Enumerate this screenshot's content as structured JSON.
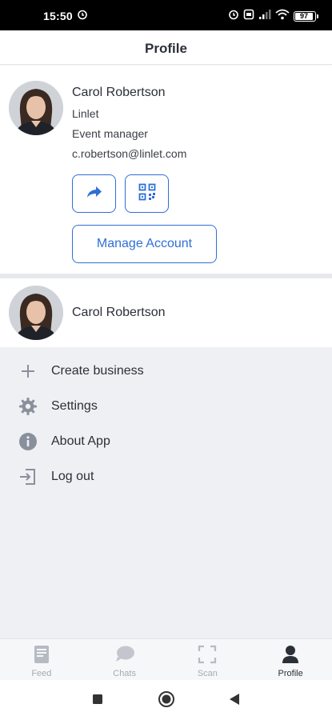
{
  "status_bar": {
    "time": "15:50",
    "battery": "97",
    "icons": [
      "alarm-icon",
      "alarm-clock-icon",
      "sim-icon",
      "signal-icon",
      "wifi-icon",
      "battery-icon"
    ]
  },
  "header": {
    "title": "Profile"
  },
  "profile": {
    "name": "Carol Robertson",
    "company": "Linlet",
    "role": "Event manager",
    "email": "c.robertson@linlet.com",
    "manage_account_label": "Manage Account"
  },
  "account": {
    "name": "Carol Robertson"
  },
  "menu": {
    "items": [
      {
        "label": "Create business",
        "icon": "plus-icon"
      },
      {
        "label": "Settings",
        "icon": "gear-icon"
      },
      {
        "label": "About App",
        "icon": "info-icon"
      },
      {
        "label": "Log out",
        "icon": "logout-icon"
      }
    ]
  },
  "bottom_nav": {
    "items": [
      {
        "label": "Feed",
        "icon": "feed-icon"
      },
      {
        "label": "Chats",
        "icon": "chat-icon"
      },
      {
        "label": "Scan",
        "icon": "scan-icon"
      },
      {
        "label": "Profile",
        "icon": "profile-icon"
      }
    ],
    "active": "Profile"
  },
  "colors": {
    "accent": "#2f6fd6",
    "text": "#2b2f38",
    "menu_background": "#eef0f3",
    "icon_gray": "#8a909b"
  }
}
